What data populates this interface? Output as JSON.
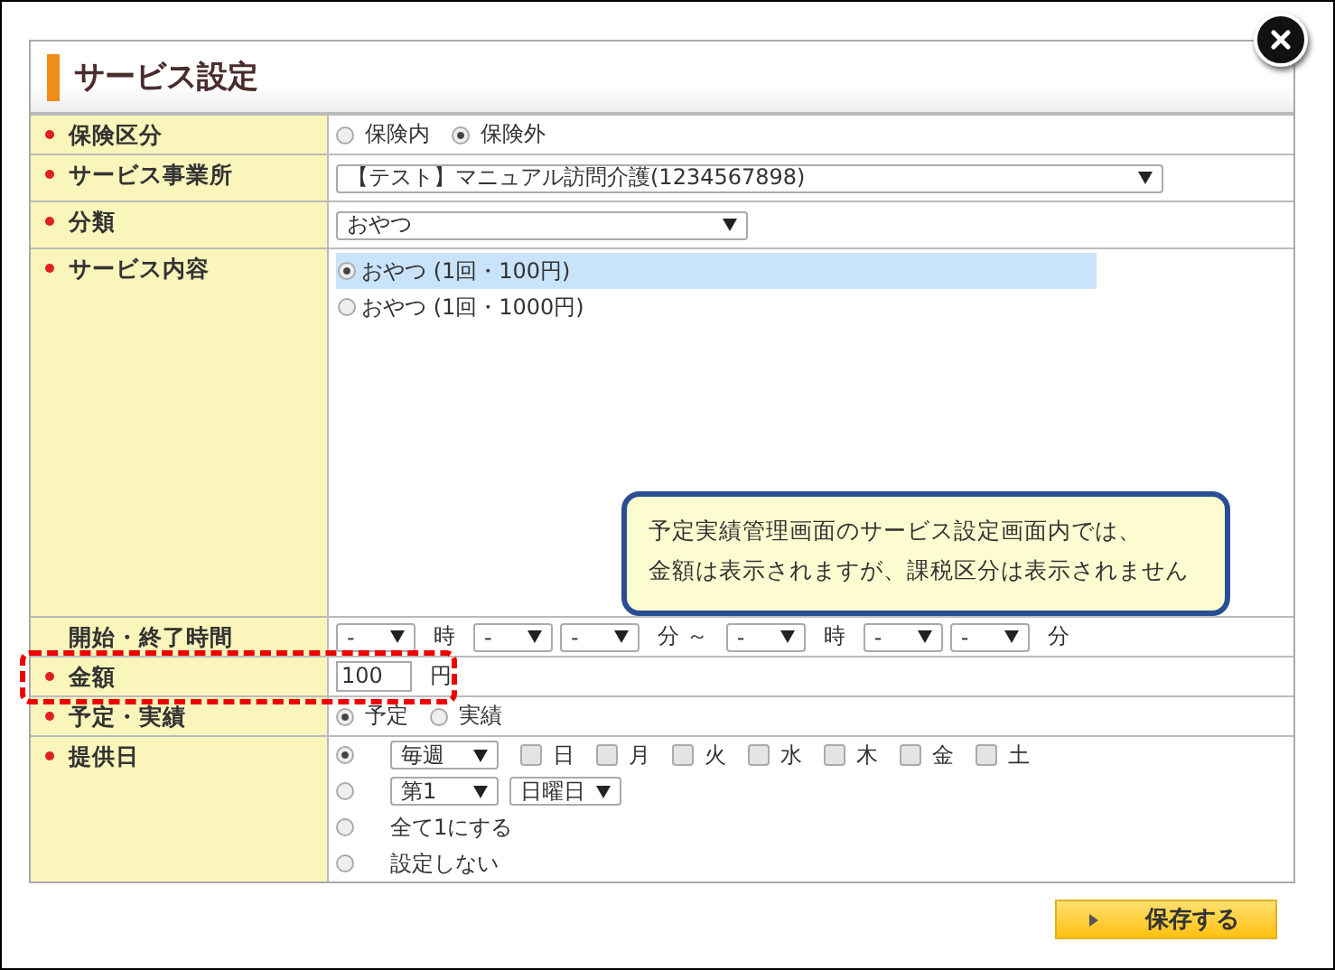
{
  "dialog": {
    "title": "サービス設定"
  },
  "rows": [
    {
      "kind": "radio",
      "label": "保険区分",
      "required": true,
      "options": [
        {
          "label": "保険内",
          "selected": false
        },
        {
          "label": "保険外",
          "selected": true
        }
      ]
    },
    {
      "kind": "select-wide",
      "label": "サービス事業所",
      "required": true,
      "value": "【テスト】マニュアル訪問介護(1234567898)"
    },
    {
      "kind": "select",
      "label": "分類",
      "required": true,
      "value": "おやつ"
    },
    {
      "kind": "radio-list",
      "label": "サービス内容",
      "required": true,
      "options": [
        {
          "label": "おやつ (1回・100円)",
          "selected": true
        },
        {
          "label": "おやつ (1回・1000円)",
          "selected": false
        }
      ]
    },
    {
      "kind": "time",
      "label": "開始・終了時間",
      "required": false,
      "parts": [
        {
          "kind": "select",
          "value": "-"
        },
        {
          "kind": "text",
          "text": "時"
        },
        {
          "kind": "select",
          "value": "-"
        },
        {
          "kind": "select",
          "value": "-"
        },
        {
          "kind": "text",
          "text": "分 ～"
        },
        {
          "kind": "select",
          "value": "-"
        },
        {
          "kind": "text",
          "text": "時"
        },
        {
          "kind": "select",
          "value": "-"
        },
        {
          "kind": "select",
          "value": "-"
        },
        {
          "kind": "text",
          "text": "分"
        }
      ]
    },
    {
      "kind": "amount",
      "label": "金額",
      "required": true,
      "value": "100",
      "unit": "円"
    },
    {
      "kind": "radio",
      "label": "予定・実績",
      "required": true,
      "options": [
        {
          "label": "予定",
          "selected": true
        },
        {
          "label": "実績",
          "selected": false
        }
      ]
    },
    {
      "kind": "schedule",
      "label": "提供日",
      "required": true,
      "lines": [
        {
          "selected": true,
          "items": [
            {
              "kind": "select",
              "value": "毎週"
            },
            {
              "kind": "check",
              "label": "日",
              "checked": false
            },
            {
              "kind": "check",
              "label": "月",
              "checked": false
            },
            {
              "kind": "check",
              "label": "火",
              "checked": false
            },
            {
              "kind": "check",
              "label": "水",
              "checked": false
            },
            {
              "kind": "check",
              "label": "木",
              "checked": false
            },
            {
              "kind": "check",
              "label": "金",
              "checked": false
            },
            {
              "kind": "check",
              "label": "土",
              "checked": false
            }
          ]
        },
        {
          "selected": false,
          "items": [
            {
              "kind": "select",
              "value": "第1"
            },
            {
              "kind": "select",
              "value": "日曜日"
            }
          ]
        },
        {
          "selected": false,
          "items": [
            {
              "kind": "text",
              "text": "全て1にする"
            }
          ]
        },
        {
          "selected": false,
          "items": [
            {
              "kind": "text",
              "text": "設定しない"
            }
          ]
        }
      ]
    }
  ],
  "callout": {
    "lines": [
      "予定実績管理画面のサービス設定画面内では、",
      "金額は表示されますが、課税区分は表示されません"
    ]
  },
  "save_button": {
    "label": "保存する"
  }
}
